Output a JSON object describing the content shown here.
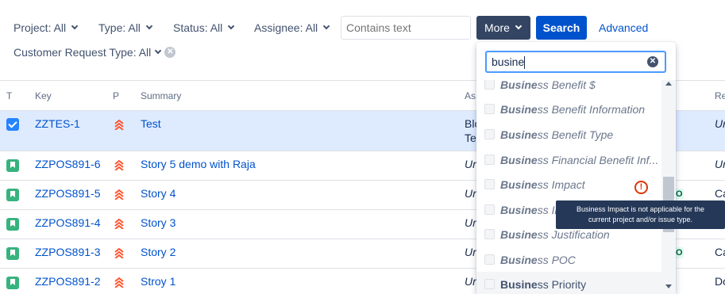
{
  "filters": {
    "project": "Project: All",
    "type": "Type: All",
    "status": "Status: All",
    "assignee": "Assignee: All",
    "text_placeholder": "Contains text",
    "more": "More",
    "search": "Search",
    "advanced": "Advanced",
    "customer_request_type": "Customer Request Type: All"
  },
  "table": {
    "headers": {
      "t": "T",
      "key": "Key",
      "p": "P",
      "summary": "Summary",
      "assignee": "As",
      "extra": "Re"
    },
    "rows": [
      {
        "key": "ZZTES-1",
        "summary": "Test",
        "assignee_1": "Blo",
        "assignee_2": "Te",
        "extra": "Ur",
        "type": "task-checkbox"
      },
      {
        "key": "ZZPOS891-6",
        "summary": "Story 5 demo with Raja",
        "assignee_1": "Un",
        "extra": "Ur",
        "type": "story"
      },
      {
        "key": "ZZPOS891-5",
        "summary": "Story 4",
        "assignee_1": "Ur",
        "extra": "Ca",
        "type": "story"
      },
      {
        "key": "ZZPOS891-4",
        "summary": "Story 3",
        "assignee_1": "Ur",
        "extra": "Ur",
        "type": "story"
      },
      {
        "key": "ZZPOS891-3",
        "summary": "Story 2",
        "assignee_1": "Ur",
        "extra": "Ca",
        "type": "story"
      },
      {
        "key": "ZZPOS891-2",
        "summary": "Stroy 1",
        "assignee_1": "Ur",
        "extra": "Do",
        "type": "story"
      }
    ],
    "lozenge_fragment": "O"
  },
  "dropdown": {
    "query": "busine",
    "items": [
      {
        "match": "Busine",
        "rest": "ss Benefit $"
      },
      {
        "match": "Busine",
        "rest": "ss Benefit Information"
      },
      {
        "match": "Busine",
        "rest": "ss Benefit Type"
      },
      {
        "match": "Busine",
        "rest": "ss Financial Benefit Inf..."
      },
      {
        "match": "Busine",
        "rest": "ss Impact"
      },
      {
        "match": "Busine",
        "rest": "ss Imp"
      },
      {
        "match": "Busine",
        "rest": "ss Justification"
      },
      {
        "match": "Busine",
        "rest": "ss POC"
      },
      {
        "match": "Busine",
        "rest": "ss Priority"
      }
    ],
    "warning_glyph": "!",
    "tooltip_line1": "Business Impact is not applicable for the",
    "tooltip_line2": "current project and/or issue type."
  },
  "icons": {
    "priority": "highest-priority-icon",
    "story": "story-icon",
    "checkbox": "checkbox-checked-icon",
    "clear": "clear-x-icon",
    "warning": "warning-icon"
  },
  "colors": {
    "primary": "#0052cc",
    "more_button": "#344563",
    "selected_row": "#deebff",
    "story_icon": "#36b37e",
    "priority": "#ff5630",
    "tooltip": "#253858"
  }
}
